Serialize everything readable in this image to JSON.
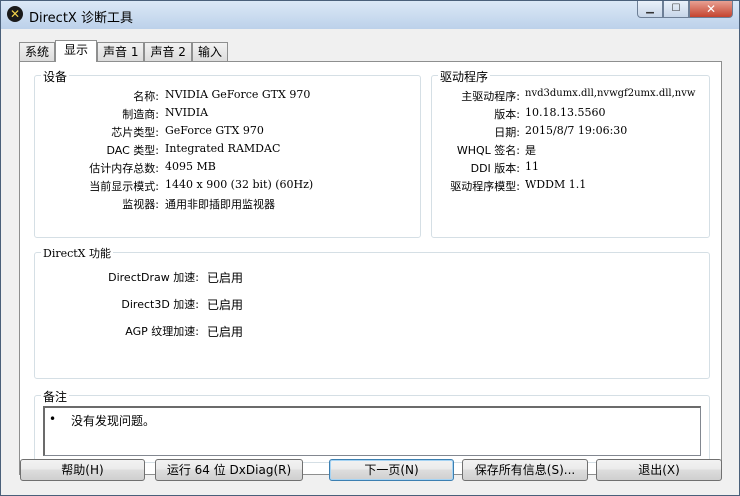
{
  "window": {
    "title": "DirectX 诊断工具"
  },
  "tabs": [
    {
      "label": "系统"
    },
    {
      "label": "显示"
    },
    {
      "label": "声音 1"
    },
    {
      "label": "声音 2"
    },
    {
      "label": "输入"
    }
  ],
  "device": {
    "title": "设备",
    "rows": [
      {
        "label": "名称:",
        "value": "NVIDIA GeForce GTX 970"
      },
      {
        "label": "制造商:",
        "value": "NVIDIA"
      },
      {
        "label": "芯片类型:",
        "value": "GeForce GTX 970"
      },
      {
        "label": "DAC 类型:",
        "value": "Integrated RAMDAC"
      },
      {
        "label": "估计内存总数:",
        "value": "4095 MB"
      },
      {
        "label": "当前显示模式:",
        "value": "1440 x 900 (32 bit) (60Hz)"
      },
      {
        "label": "监视器:",
        "value": "通用非即插即用监视器"
      }
    ]
  },
  "driver": {
    "title": "驱动程序",
    "rows": [
      {
        "label": "主驱动程序:",
        "value": "nvd3dumx.dll,nvwgf2umx.dll,nvw"
      },
      {
        "label": "版本:",
        "value": "10.18.13.5560"
      },
      {
        "label": "日期:",
        "value": "2015/8/7 19:06:30"
      },
      {
        "label": "WHQL 签名:",
        "value": "是"
      },
      {
        "label": "DDI 版本:",
        "value": "11"
      },
      {
        "label": "驱动程序模型:",
        "value": "WDDM 1.1"
      }
    ]
  },
  "directx": {
    "title": "DirectX 功能",
    "rows": [
      {
        "label": "DirectDraw 加速:",
        "value": "已启用"
      },
      {
        "label": "Direct3D 加速:",
        "value": "已启用"
      },
      {
        "label": "AGP 纹理加速:",
        "value": "已启用"
      }
    ]
  },
  "notes": {
    "title": "备注",
    "items": [
      {
        "bullet": "•",
        "text": "没有发现问题。"
      }
    ]
  },
  "buttons": {
    "help": "帮助(H)",
    "run64": "运行 64 位 DxDiag(R)",
    "next": "下一页(N)",
    "save": "保存所有信息(S)...",
    "exit": "退出(X)"
  }
}
